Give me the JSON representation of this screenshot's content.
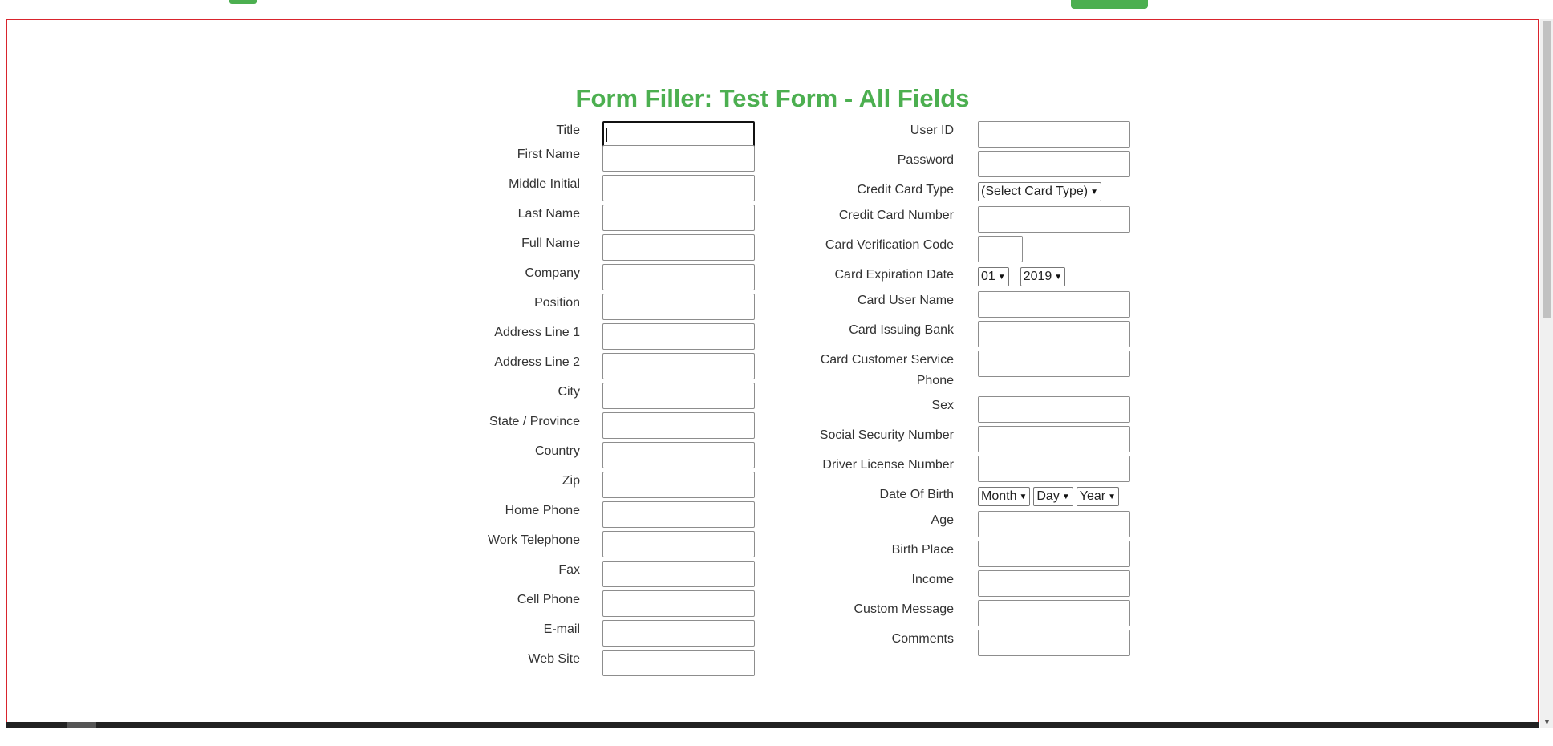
{
  "page": {
    "title": "Form Filler: Test Form - All Fields"
  },
  "left_fields": [
    {
      "label": "Title",
      "value": ""
    },
    {
      "label": "First Name",
      "value": ""
    },
    {
      "label": "Middle Initial",
      "value": ""
    },
    {
      "label": "Last Name",
      "value": ""
    },
    {
      "label": "Full Name",
      "value": ""
    },
    {
      "label": "Company",
      "value": ""
    },
    {
      "label": "Position",
      "value": ""
    },
    {
      "label": "Address Line 1",
      "value": ""
    },
    {
      "label": "Address Line 2",
      "value": ""
    },
    {
      "label": "City",
      "value": ""
    },
    {
      "label": "State / Province",
      "value": ""
    },
    {
      "label": "Country",
      "value": ""
    },
    {
      "label": "Zip",
      "value": ""
    },
    {
      "label": "Home Phone",
      "value": ""
    },
    {
      "label": "Work Telephone",
      "value": ""
    },
    {
      "label": "Fax",
      "value": ""
    },
    {
      "label": "Cell Phone",
      "value": ""
    },
    {
      "label": "E-mail",
      "value": ""
    },
    {
      "label": "Web Site",
      "value": ""
    }
  ],
  "right_fields": {
    "user_id": "User ID",
    "password": "Password",
    "card_type": {
      "label": "Credit Card Type",
      "selected": "(Select Card Type)"
    },
    "card_number": "Credit Card Number",
    "card_cvc": "Card Verification Code",
    "card_expiry": {
      "label": "Card Expiration Date",
      "month": "01",
      "year": "2019"
    },
    "card_user_name": "Card User Name",
    "card_bank": "Card Issuing Bank",
    "card_service_phone": "Card Customer Service Phone",
    "sex": "Sex",
    "ssn": "Social Security Number",
    "driver_license": "Driver License Number",
    "dob": {
      "label": "Date Of Birth",
      "month": "Month",
      "day": "Day",
      "year": "Year"
    },
    "age": "Age",
    "birth_place": "Birth Place",
    "income": "Income",
    "custom_message": "Custom Message",
    "comments": "Comments"
  },
  "colors": {
    "accent": "#4caf50",
    "frame_border": "#d9242d"
  },
  "icons": {
    "select": "chevron-down-icon"
  }
}
